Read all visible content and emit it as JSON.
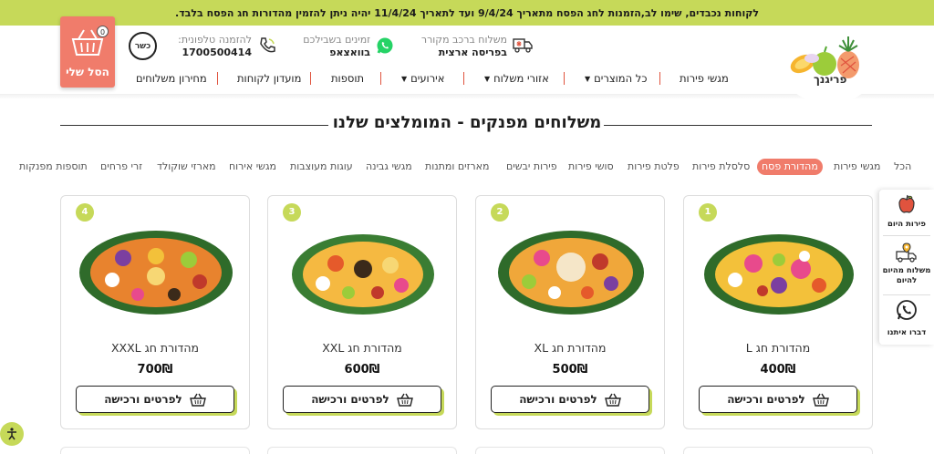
{
  "announcement": "לקוחות נכבדים, שימו לב,הזמנות לחג הפסח מתאריך 9/4/24 ועד לתאריך 11/4/24 יהיה ניתן להזמין מהדורות חג הפסח בלבד.",
  "header": {
    "cart_label": "הסל שלי",
    "cart_count": "0",
    "kosher_label": "כשר",
    "phone_label": "להזמנה טלפונית:",
    "phone_number": "1700500414",
    "whatsapp_label": "זמינים בשבילכם",
    "whatsapp_value": "בוואצאפ",
    "delivery_label": "משלוח ברכב מקורר",
    "delivery_value": "בפריסה ארצית",
    "logo_text": "פריגנך"
  },
  "nav": [
    {
      "label": "מגשי פירות",
      "caret": false
    },
    {
      "label": "כל המוצרים",
      "caret": true
    },
    {
      "label": "אזורי משלוח",
      "caret": true
    },
    {
      "label": "אירועים",
      "caret": true
    },
    {
      "label": "תוספות",
      "caret": false
    },
    {
      "label": "מועדון לקוחות",
      "caret": false
    },
    {
      "label": "מחירון משלוחים",
      "caret": false
    }
  ],
  "section_title": "משלוחים מפנקים - המומלצים שלנו",
  "categories": [
    "הכל",
    "מגשי פירות",
    "מהדורת פסח",
    "סלסלת פירות",
    "פלטת פירות",
    "סושי פירות",
    "פירות יבשים",
    "מארזים ומתנות",
    "מגשי גבינה",
    "עוגות מעוצבות",
    "מגשי אירוח",
    "מארזי שוקולד",
    "זרי פרחים",
    "תוספות מפנקות"
  ],
  "active_category": "מהדורת פסח",
  "products": [
    {
      "num": "1",
      "name": "מהדורת חג L",
      "price": "400₪",
      "button": "לפרטים ורכישה"
    },
    {
      "num": "2",
      "name": "מהדורת חג XL",
      "price": "500₪",
      "button": "לפרטים ורכישה"
    },
    {
      "num": "3",
      "name": "מהדורת חג XXL",
      "price": "600₪",
      "button": "לפרטים ורכישה"
    },
    {
      "num": "4",
      "name": "מהדורת חג XXXL",
      "price": "700₪",
      "button": "לפרטים ורכישה"
    }
  ],
  "side_panel": [
    {
      "label": "פירות היום",
      "icon": "apple-icon"
    },
    {
      "label": "משלוח מהיום להיום",
      "icon": "delivery-truck-icon"
    },
    {
      "label": "דברו איתנו",
      "icon": "whatsapp-icon"
    }
  ],
  "colors": {
    "accent_green": "#c6d959",
    "accent_coral": "#f07c6b",
    "whatsapp": "#25d366"
  }
}
